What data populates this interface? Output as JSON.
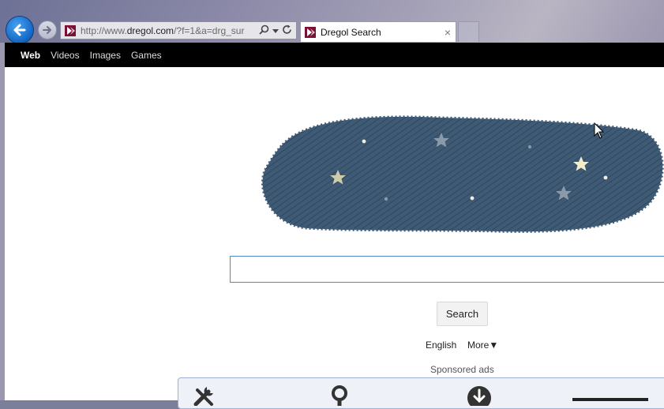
{
  "browser": {
    "url_prefix": "http://www.",
    "url_domain": "dregol.com",
    "url_suffix": "/?f=1&a=drg_sur",
    "tab_title": "Dregol Search",
    "tab_close": "×",
    "back_icon": "back-arrow-icon",
    "forward_icon": "forward-arrow-icon",
    "accent_color": "#1265c4",
    "favicon_color": "#7a1034"
  },
  "nav": {
    "items": [
      {
        "label": "Web",
        "active": true
      },
      {
        "label": "Videos",
        "active": false
      },
      {
        "label": "Images",
        "active": false
      },
      {
        "label": "Games",
        "active": false
      }
    ]
  },
  "search": {
    "query": "",
    "button_label": "Search",
    "language": "English",
    "more_label": "More▼"
  },
  "sponsored": {
    "label": "Sponsored ads",
    "icons": [
      "tools-icon",
      "magnifier-icon",
      "download-icon"
    ]
  },
  "logo": {
    "color": "#3e5a75",
    "star_color": "#e9e4c8"
  }
}
